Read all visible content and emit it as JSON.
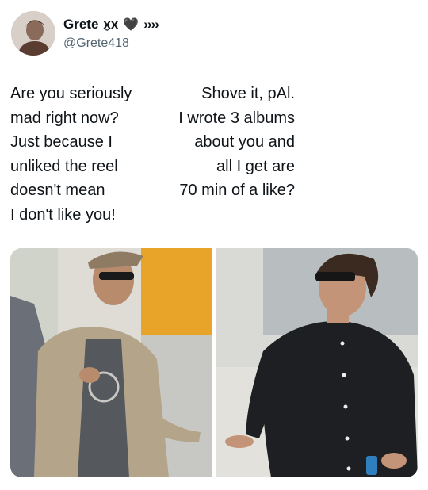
{
  "author": {
    "display_name": "Grete",
    "name_decoration": "x̼x",
    "heart_emoji": "🖤",
    "arrows": "››››",
    "handle": "@Grete418"
  },
  "tweet": {
    "left_text": "Are you seriously\nmad right now?\nJust because I\nunliked the reel\ndoesn't mean\nI don't like you!",
    "right_text": "Shove it, pAl.\nI wrote 3 albums\nabout you and\nall I get are\n70 min of a like?"
  },
  "media": {
    "photo_1_icon": "man-in-cap-and-jacket-photo",
    "photo_2_icon": "man-in-black-shirt-photo"
  }
}
